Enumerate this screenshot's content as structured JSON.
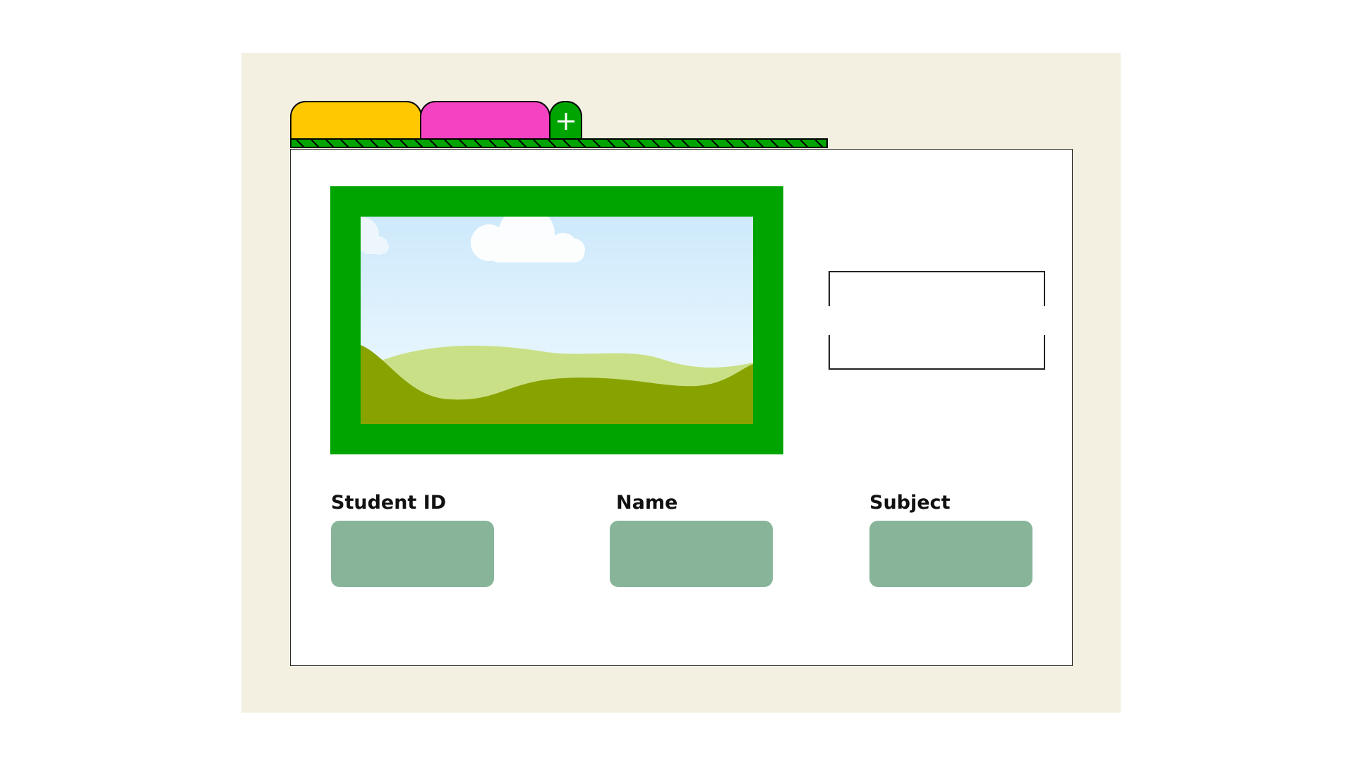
{
  "colors": {
    "page_background": "#f3f0e1",
    "tab_yellow": "#ffc800",
    "tab_pink": "#f542c2",
    "accent_green": "#00a400",
    "field_fill": "#88b59a",
    "sky_top": "#cde9fb",
    "sky_bottom": "#f2fbff",
    "hill_light": "#c9e087",
    "hill_dark": "#88a300"
  },
  "tabs": [
    {
      "color": "#ffc800"
    },
    {
      "color": "#f542c2"
    }
  ],
  "add_tab": {
    "icon": "plus-icon",
    "color": "#00a400"
  },
  "image_placeholder": {
    "icon": "landscape-image-icon",
    "frame_color": "#00a400"
  },
  "side_box": {
    "icon": "bracket-frame-icon"
  },
  "fields": [
    {
      "label": "Student ID",
      "value": ""
    },
    {
      "label": "Name",
      "value": ""
    },
    {
      "label": "Subject",
      "value": ""
    }
  ]
}
